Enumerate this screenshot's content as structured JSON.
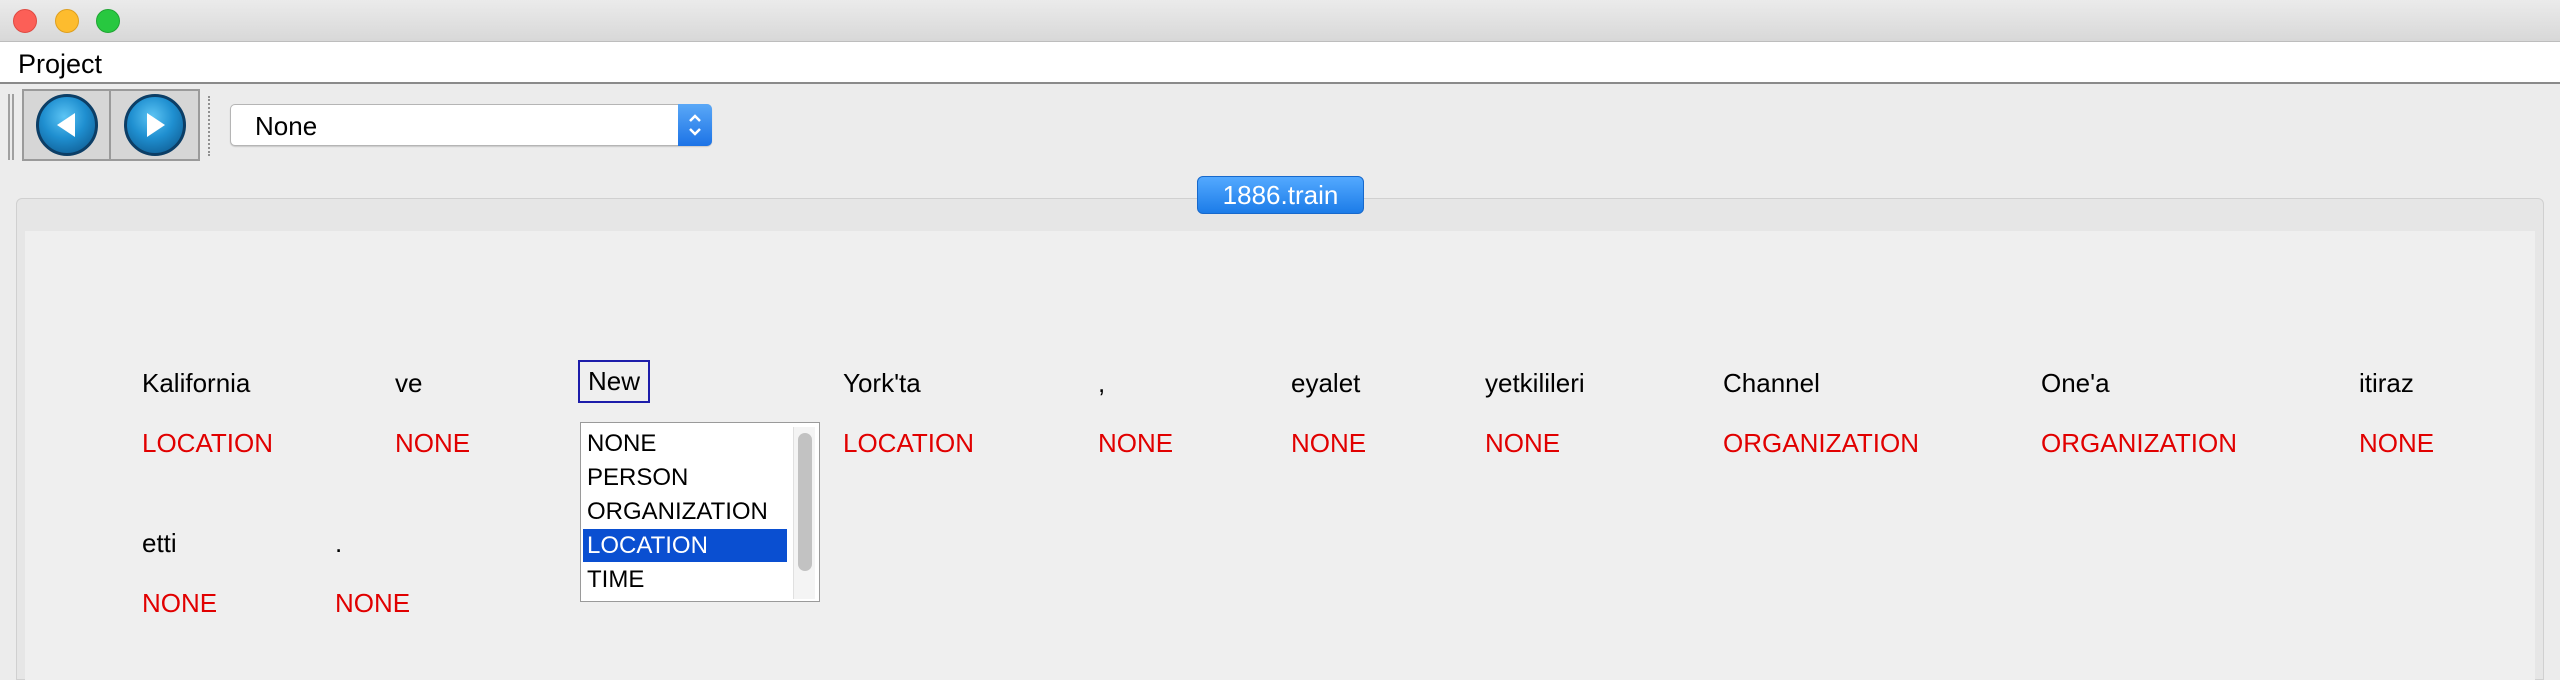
{
  "menu": {
    "items": [
      "Project"
    ]
  },
  "toolbar": {
    "back_icon": "back-arrow-icon",
    "forward_icon": "forward-arrow-icon",
    "select_value": "None"
  },
  "tab": {
    "label": "1886.train"
  },
  "tokens": [
    {
      "word": "Kalifornia",
      "label": "LOCATION"
    },
    {
      "word": "ve",
      "label": "NONE"
    },
    {
      "word": "New",
      "label": "LOCATION"
    },
    {
      "word": "York'ta",
      "label": "LOCATION"
    },
    {
      "word": ",",
      "label": "NONE"
    },
    {
      "word": "eyalet",
      "label": "NONE"
    },
    {
      "word": "yetkilileri",
      "label": "NONE"
    },
    {
      "word": "Channel",
      "label": "ORGANIZATION"
    },
    {
      "word": "One'a",
      "label": "ORGANIZATION"
    },
    {
      "word": "itiraz",
      "label": "NONE"
    },
    {
      "word": "etti",
      "label": "NONE"
    },
    {
      "word": ".",
      "label": "NONE"
    }
  ],
  "dropdown": {
    "options": [
      "NONE",
      "PERSON",
      "ORGANIZATION",
      "LOCATION",
      "TIME"
    ],
    "selected": "LOCATION"
  },
  "colors": {
    "label": "#e10000",
    "selection": "#0a4fd1",
    "tab": "#1c7ce8"
  }
}
